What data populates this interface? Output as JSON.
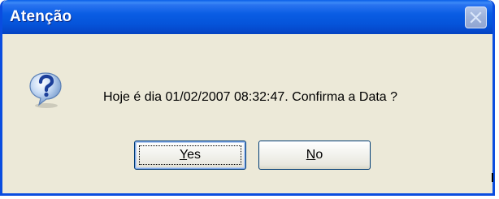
{
  "window": {
    "title": "Atenção"
  },
  "message": {
    "text": "Hoje é dia 01/02/2007 08:32:47. Confirma  a Data ?"
  },
  "buttons": {
    "yes": {
      "mnemonic": "Y",
      "rest": "es"
    },
    "no": {
      "mnemonic": "N",
      "rest": "o"
    }
  },
  "icons": {
    "dialog_icon": "question-icon",
    "close": "close-icon"
  },
  "colors": {
    "titlebar": "#0a5de4",
    "client": "#ece9d8",
    "border": "#0a4de0"
  }
}
